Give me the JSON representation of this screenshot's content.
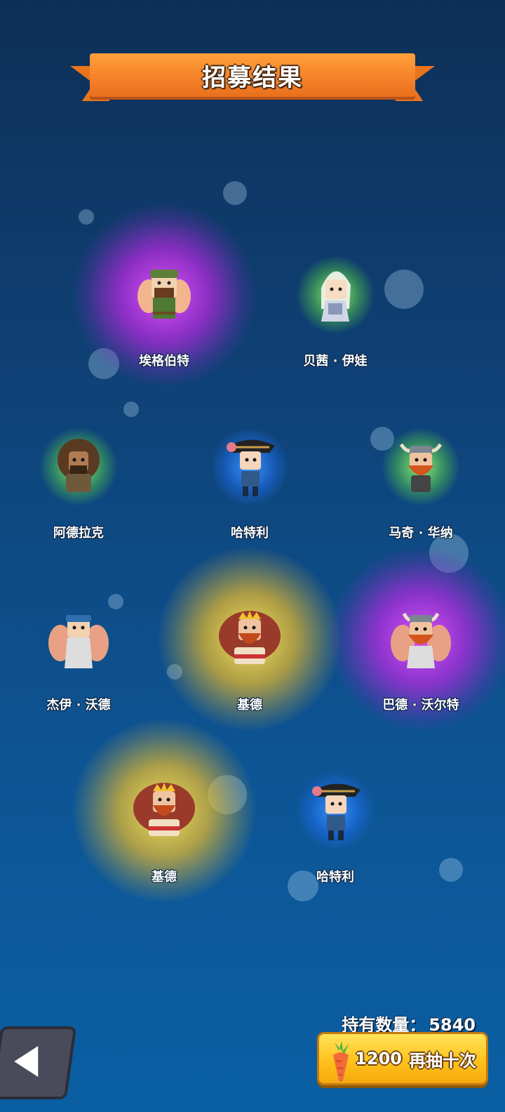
{
  "screen": {
    "title": "招募结果"
  },
  "heroes": [
    {
      "name": "埃格伯特",
      "rarity_glow": "purple"
    },
    {
      "name": "贝茜 · 伊娃",
      "rarity_glow": "green"
    },
    {
      "name": "阿德拉克",
      "rarity_glow": "green"
    },
    {
      "name": "哈特利",
      "rarity_glow": "blue"
    },
    {
      "name": "马奇 · 华纳",
      "rarity_glow": "green"
    },
    {
      "name": "杰伊 · 沃德",
      "rarity_glow": "none"
    },
    {
      "name": "基德",
      "rarity_glow": "gold"
    },
    {
      "name": "巴德 · 沃尔特",
      "rarity_glow": "purple"
    },
    {
      "name": "基德",
      "rarity_glow": "gold"
    },
    {
      "name": "哈特利",
      "rarity_glow": "blue"
    }
  ],
  "footer": {
    "owned_label": "持有数量：",
    "owned_count": "5840",
    "redraw_cost": "1200",
    "redraw_label": "再抽十次",
    "back_icon": "back-arrow-icon",
    "currency_icon": "carrot-icon"
  },
  "colors": {
    "banner": "#f6822a",
    "button": "#ffc21d",
    "purple_glow": "#d94cff",
    "gold_glow": "#ffd84a",
    "green_glow": "#8fff6a",
    "blue_glow": "#2f8cff"
  }
}
